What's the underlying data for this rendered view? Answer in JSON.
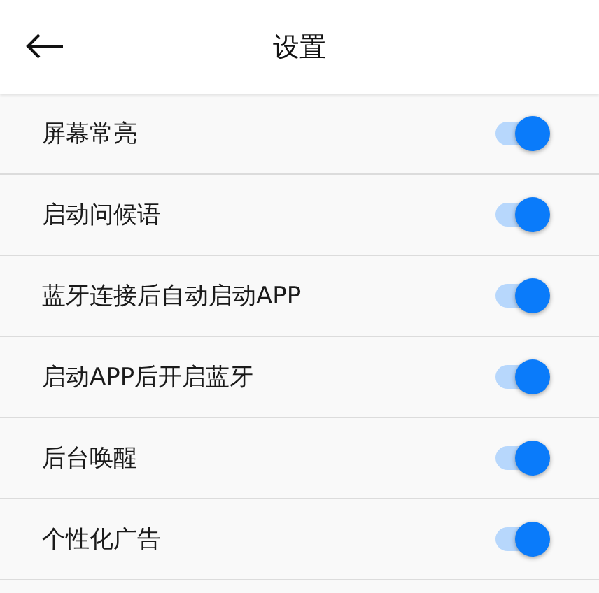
{
  "header": {
    "title": "设置"
  },
  "settings": [
    {
      "label": "屏幕常亮",
      "on": true
    },
    {
      "label": "启动问候语",
      "on": true
    },
    {
      "label": "蓝牙连接后自动启动APP",
      "on": true
    },
    {
      "label": "启动APP后开启蓝牙",
      "on": true
    },
    {
      "label": "后台唤醒",
      "on": true
    },
    {
      "label": "个性化广告",
      "on": true
    }
  ]
}
